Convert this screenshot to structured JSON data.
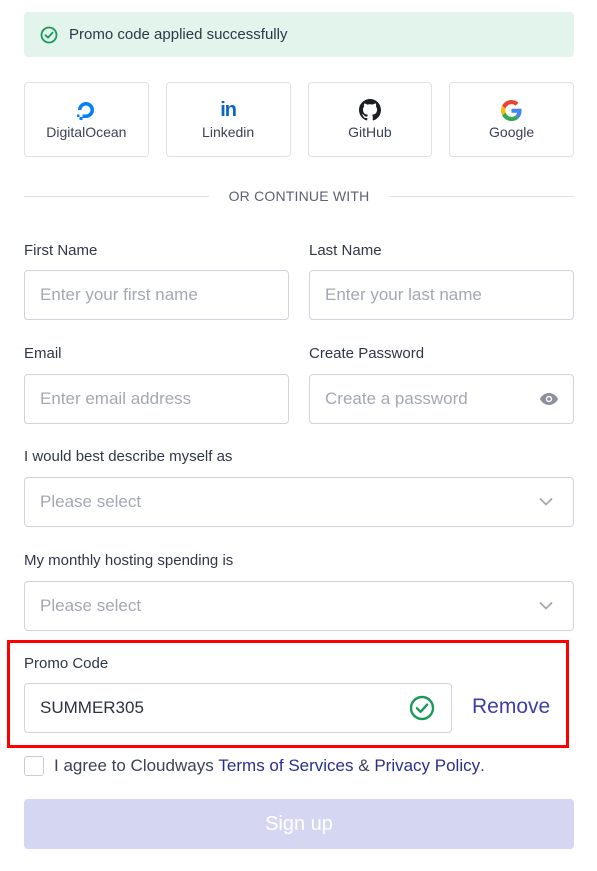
{
  "banner": {
    "text": "Promo code applied successfully",
    "icon": "check-circle-icon"
  },
  "social": [
    {
      "label": "DigitalOcean",
      "icon": "digitalocean-icon"
    },
    {
      "label": "Linkedin",
      "icon": "linkedin-icon",
      "glyph": "in"
    },
    {
      "label": "GitHub",
      "icon": "github-icon"
    },
    {
      "label": "Google",
      "icon": "google-icon"
    }
  ],
  "divider_text": "OR CONTINUE WITH",
  "form": {
    "first_name": {
      "label": "First Name",
      "placeholder": "Enter your first name"
    },
    "last_name": {
      "label": "Last Name",
      "placeholder": "Enter your last name"
    },
    "email": {
      "label": "Email",
      "placeholder": "Enter email address"
    },
    "password": {
      "label": "Create Password",
      "placeholder": "Create a password",
      "icon": "eye-icon"
    },
    "describe": {
      "label": "I would best describe myself as",
      "selected": "Please select"
    },
    "spending": {
      "label": "My monthly hosting spending is",
      "selected": "Please select"
    },
    "promo": {
      "label": "Promo Code",
      "value": "SUMMER305",
      "remove_label": "Remove",
      "status_icon": "check-circle-icon"
    }
  },
  "agree": {
    "prefix": "I agree to Cloudways ",
    "terms_link": "Terms of Services",
    "middle": " & ",
    "privacy_link": "Privacy Policy",
    "suffix": "."
  },
  "signup_label": "Sign up",
  "colors": {
    "banner_bg": "#e3f4ec",
    "success_green": "#1a9a5a",
    "link_blue": "#2a2f8f",
    "signup_bg": "#d5d6f2",
    "highlight_red": "#ff0000"
  }
}
